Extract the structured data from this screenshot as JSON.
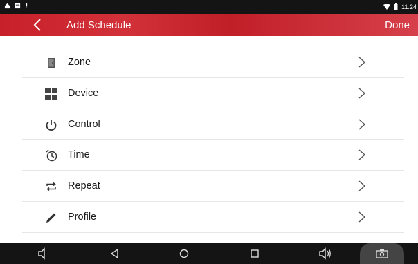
{
  "status_bar": {
    "left_icons": [
      "home-icon",
      "notification-icon",
      "alert-icon"
    ],
    "right_icons": [
      "wifi-icon",
      "battery-icon"
    ],
    "time": "11:24"
  },
  "app_bar": {
    "title": "Add Schedule",
    "done_label": "Done",
    "back_icon": "chevron-left-icon",
    "background": "#c8202a"
  },
  "items": [
    {
      "label": "Zone",
      "icon": "door-icon"
    },
    {
      "label": "Device",
      "icon": "grid-icon"
    },
    {
      "label": "Control",
      "icon": "power-icon"
    },
    {
      "label": "Time",
      "icon": "clock-icon"
    },
    {
      "label": "Repeat",
      "icon": "repeat-icon"
    },
    {
      "label": "Profile",
      "icon": "pencil-icon"
    }
  ],
  "nav_bar": {
    "buttons": [
      "volume-down-icon",
      "back-triangle-icon",
      "home-circle-icon",
      "recents-square-icon",
      "volume-up-icon",
      "screenshot-icon"
    ]
  }
}
